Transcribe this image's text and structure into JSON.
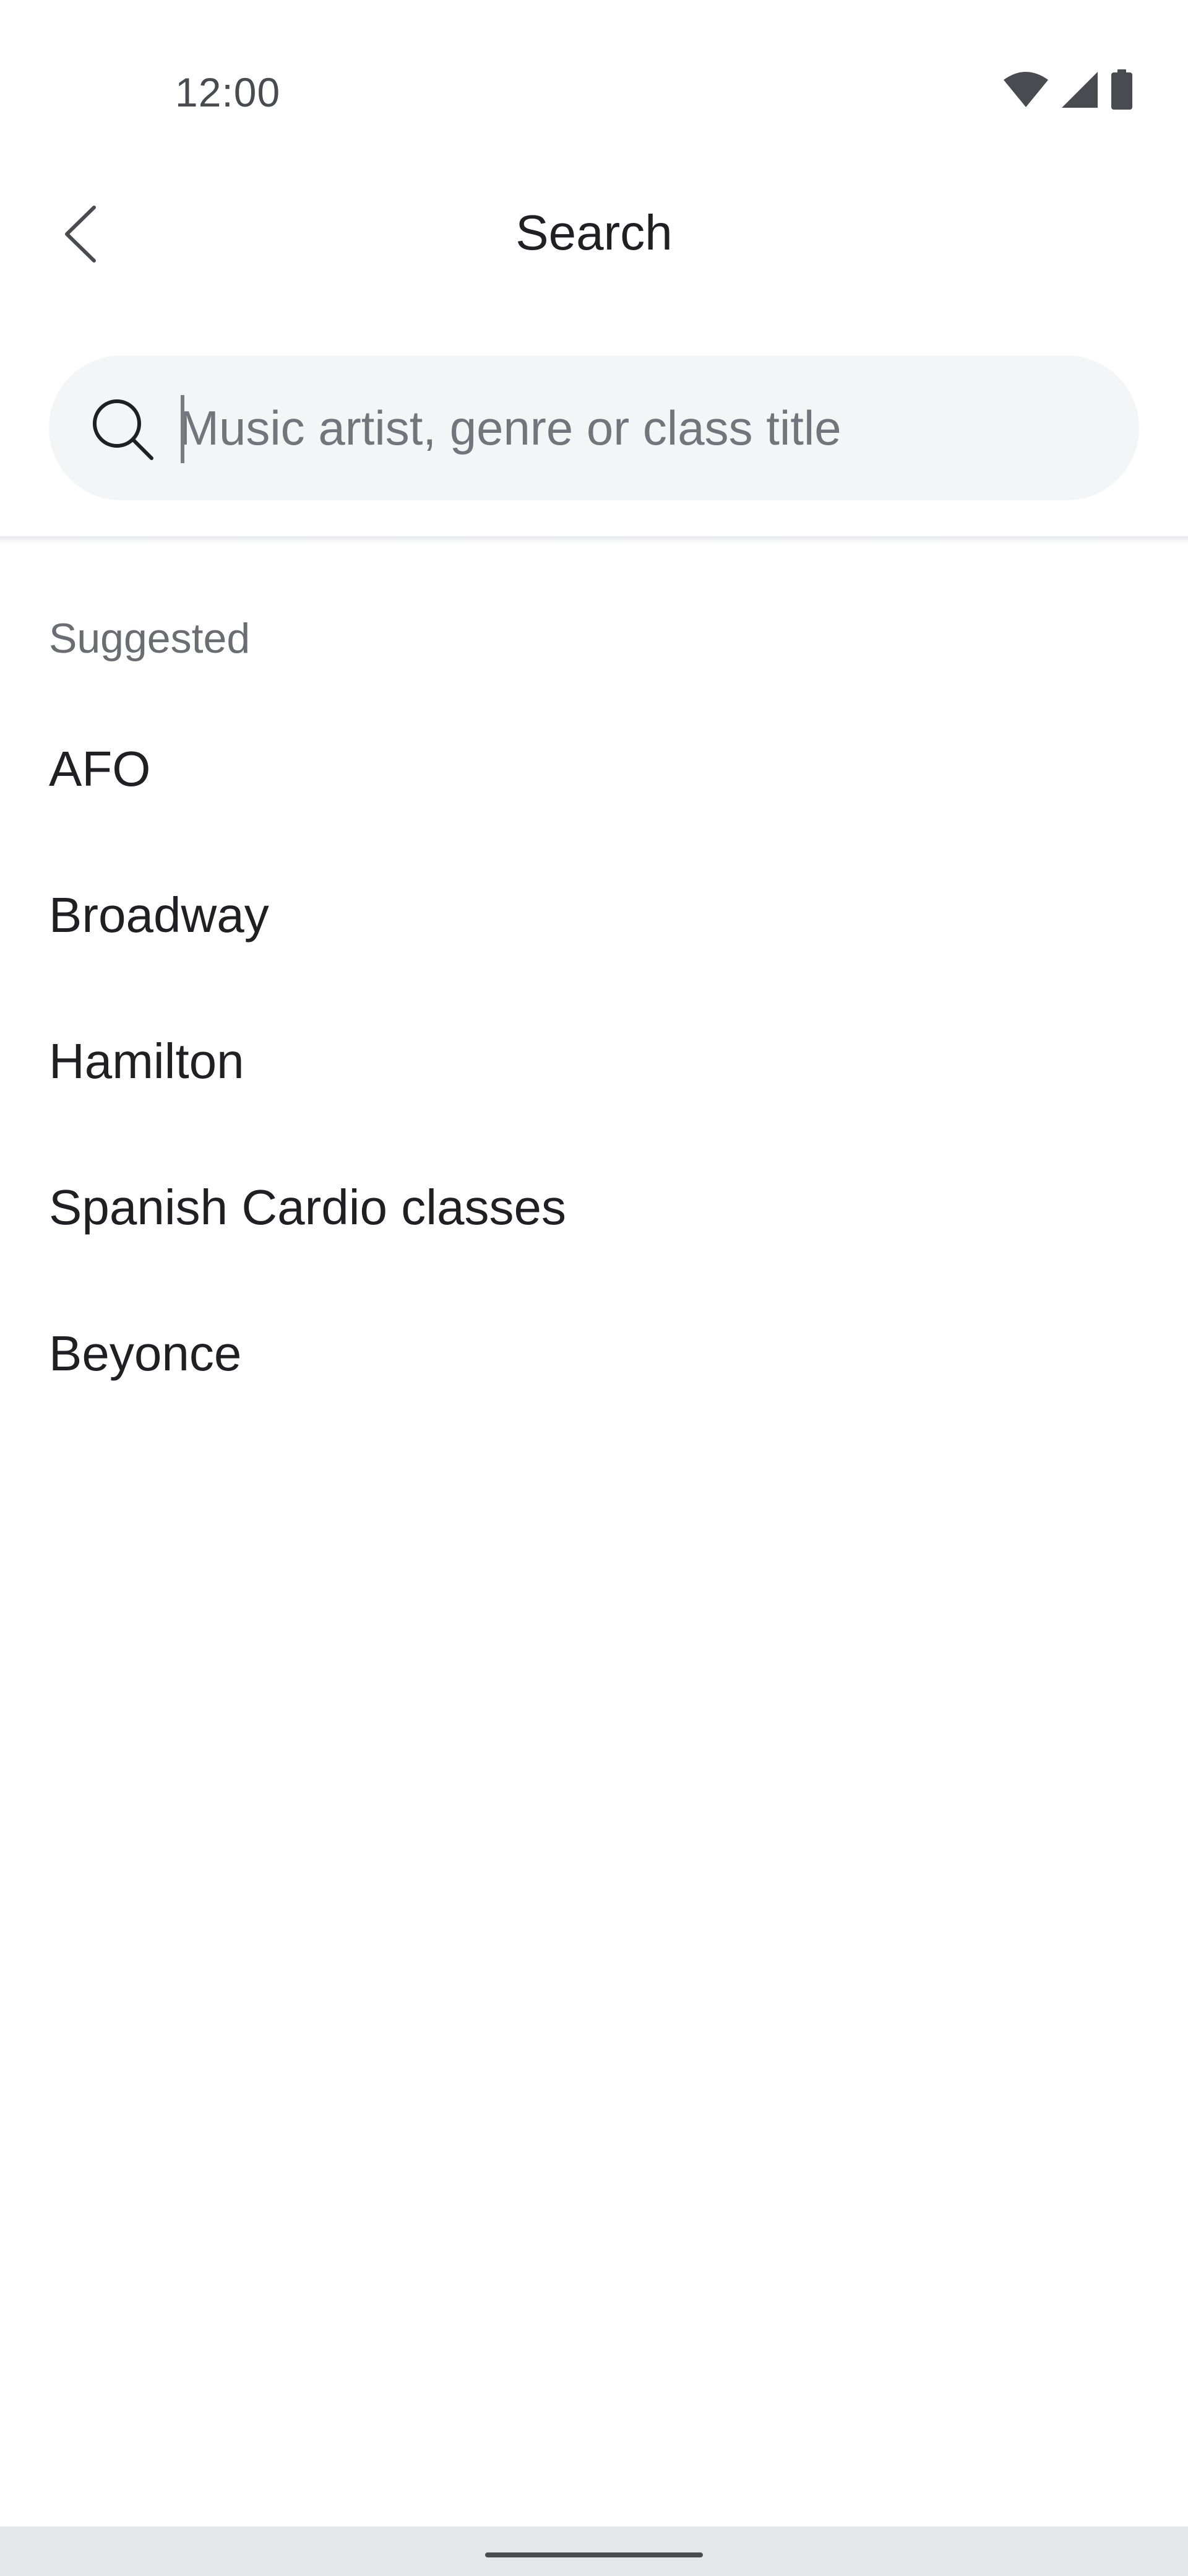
{
  "status_bar": {
    "time": "12:00",
    "icons": [
      "wifi-icon",
      "cellular-signal-icon",
      "battery-icon"
    ]
  },
  "header": {
    "title": "Search",
    "back_icon": "chevron-left-icon"
  },
  "search": {
    "placeholder": "Music artist, genre or class title",
    "value": "",
    "icon": "search-icon"
  },
  "suggested": {
    "heading": "Suggested",
    "items": [
      "AFO",
      "Broadway",
      "Hamilton",
      "Spanish Cardio classes",
      "Beyonce"
    ]
  },
  "colors": {
    "text_primary": "#1f1f24",
    "text_secondary": "#6b6d73",
    "search_background": "#f4f5f7",
    "nav_bar": "#e6e7ea"
  }
}
